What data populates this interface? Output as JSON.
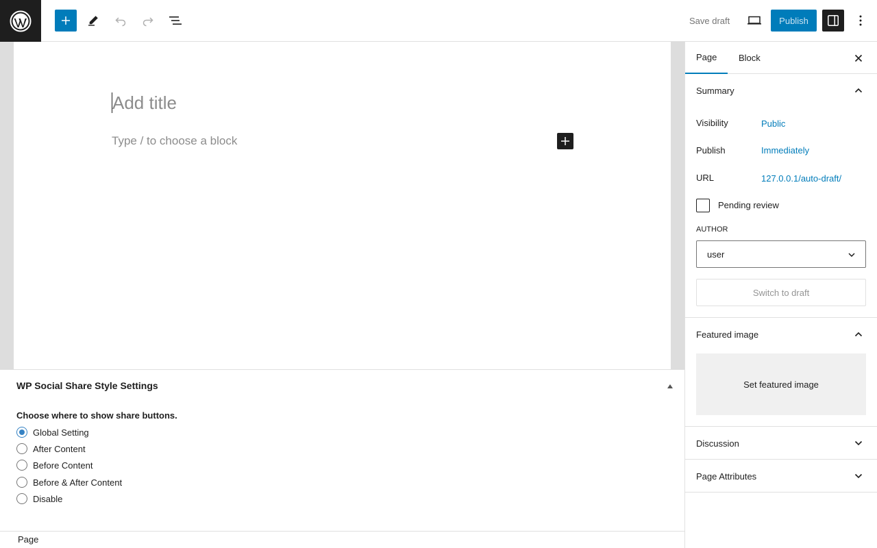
{
  "toolbar": {
    "save_draft_label": "Save draft",
    "publish_label": "Publish"
  },
  "editor": {
    "title_placeholder": "Add title",
    "block_placeholder": "Type / to choose a block"
  },
  "metabox": {
    "title": "WP Social Share Style Settings",
    "question": "Choose where to show share buttons.",
    "options": [
      {
        "label": "Global Setting",
        "checked": true
      },
      {
        "label": "After Content",
        "checked": false
      },
      {
        "label": "Before Content",
        "checked": false
      },
      {
        "label": "Before & After Content",
        "checked": false
      },
      {
        "label": "Disable",
        "checked": false
      }
    ]
  },
  "footer": {
    "breadcrumb": "Page"
  },
  "sidebar": {
    "tabs": [
      {
        "label": "Page",
        "active": true
      },
      {
        "label": "Block",
        "active": false
      }
    ],
    "summary": {
      "title": "Summary",
      "visibility_label": "Visibility",
      "visibility_value": "Public",
      "publish_label": "Publish",
      "publish_value": "Immediately",
      "url_label": "URL",
      "url_value": "127.0.0.1/auto-draft/",
      "pending_review_label": "Pending review",
      "author_label": "AUTHOR",
      "author_value": "user",
      "switch_to_draft_label": "Switch to draft"
    },
    "featured_image": {
      "title": "Featured image",
      "set_label": "Set featured image"
    },
    "discussion": {
      "title": "Discussion"
    },
    "page_attributes": {
      "title": "Page Attributes"
    }
  },
  "colors": {
    "accent": "#007cba",
    "dark": "#1e1e1e",
    "radio_checked": "#3582c4"
  }
}
